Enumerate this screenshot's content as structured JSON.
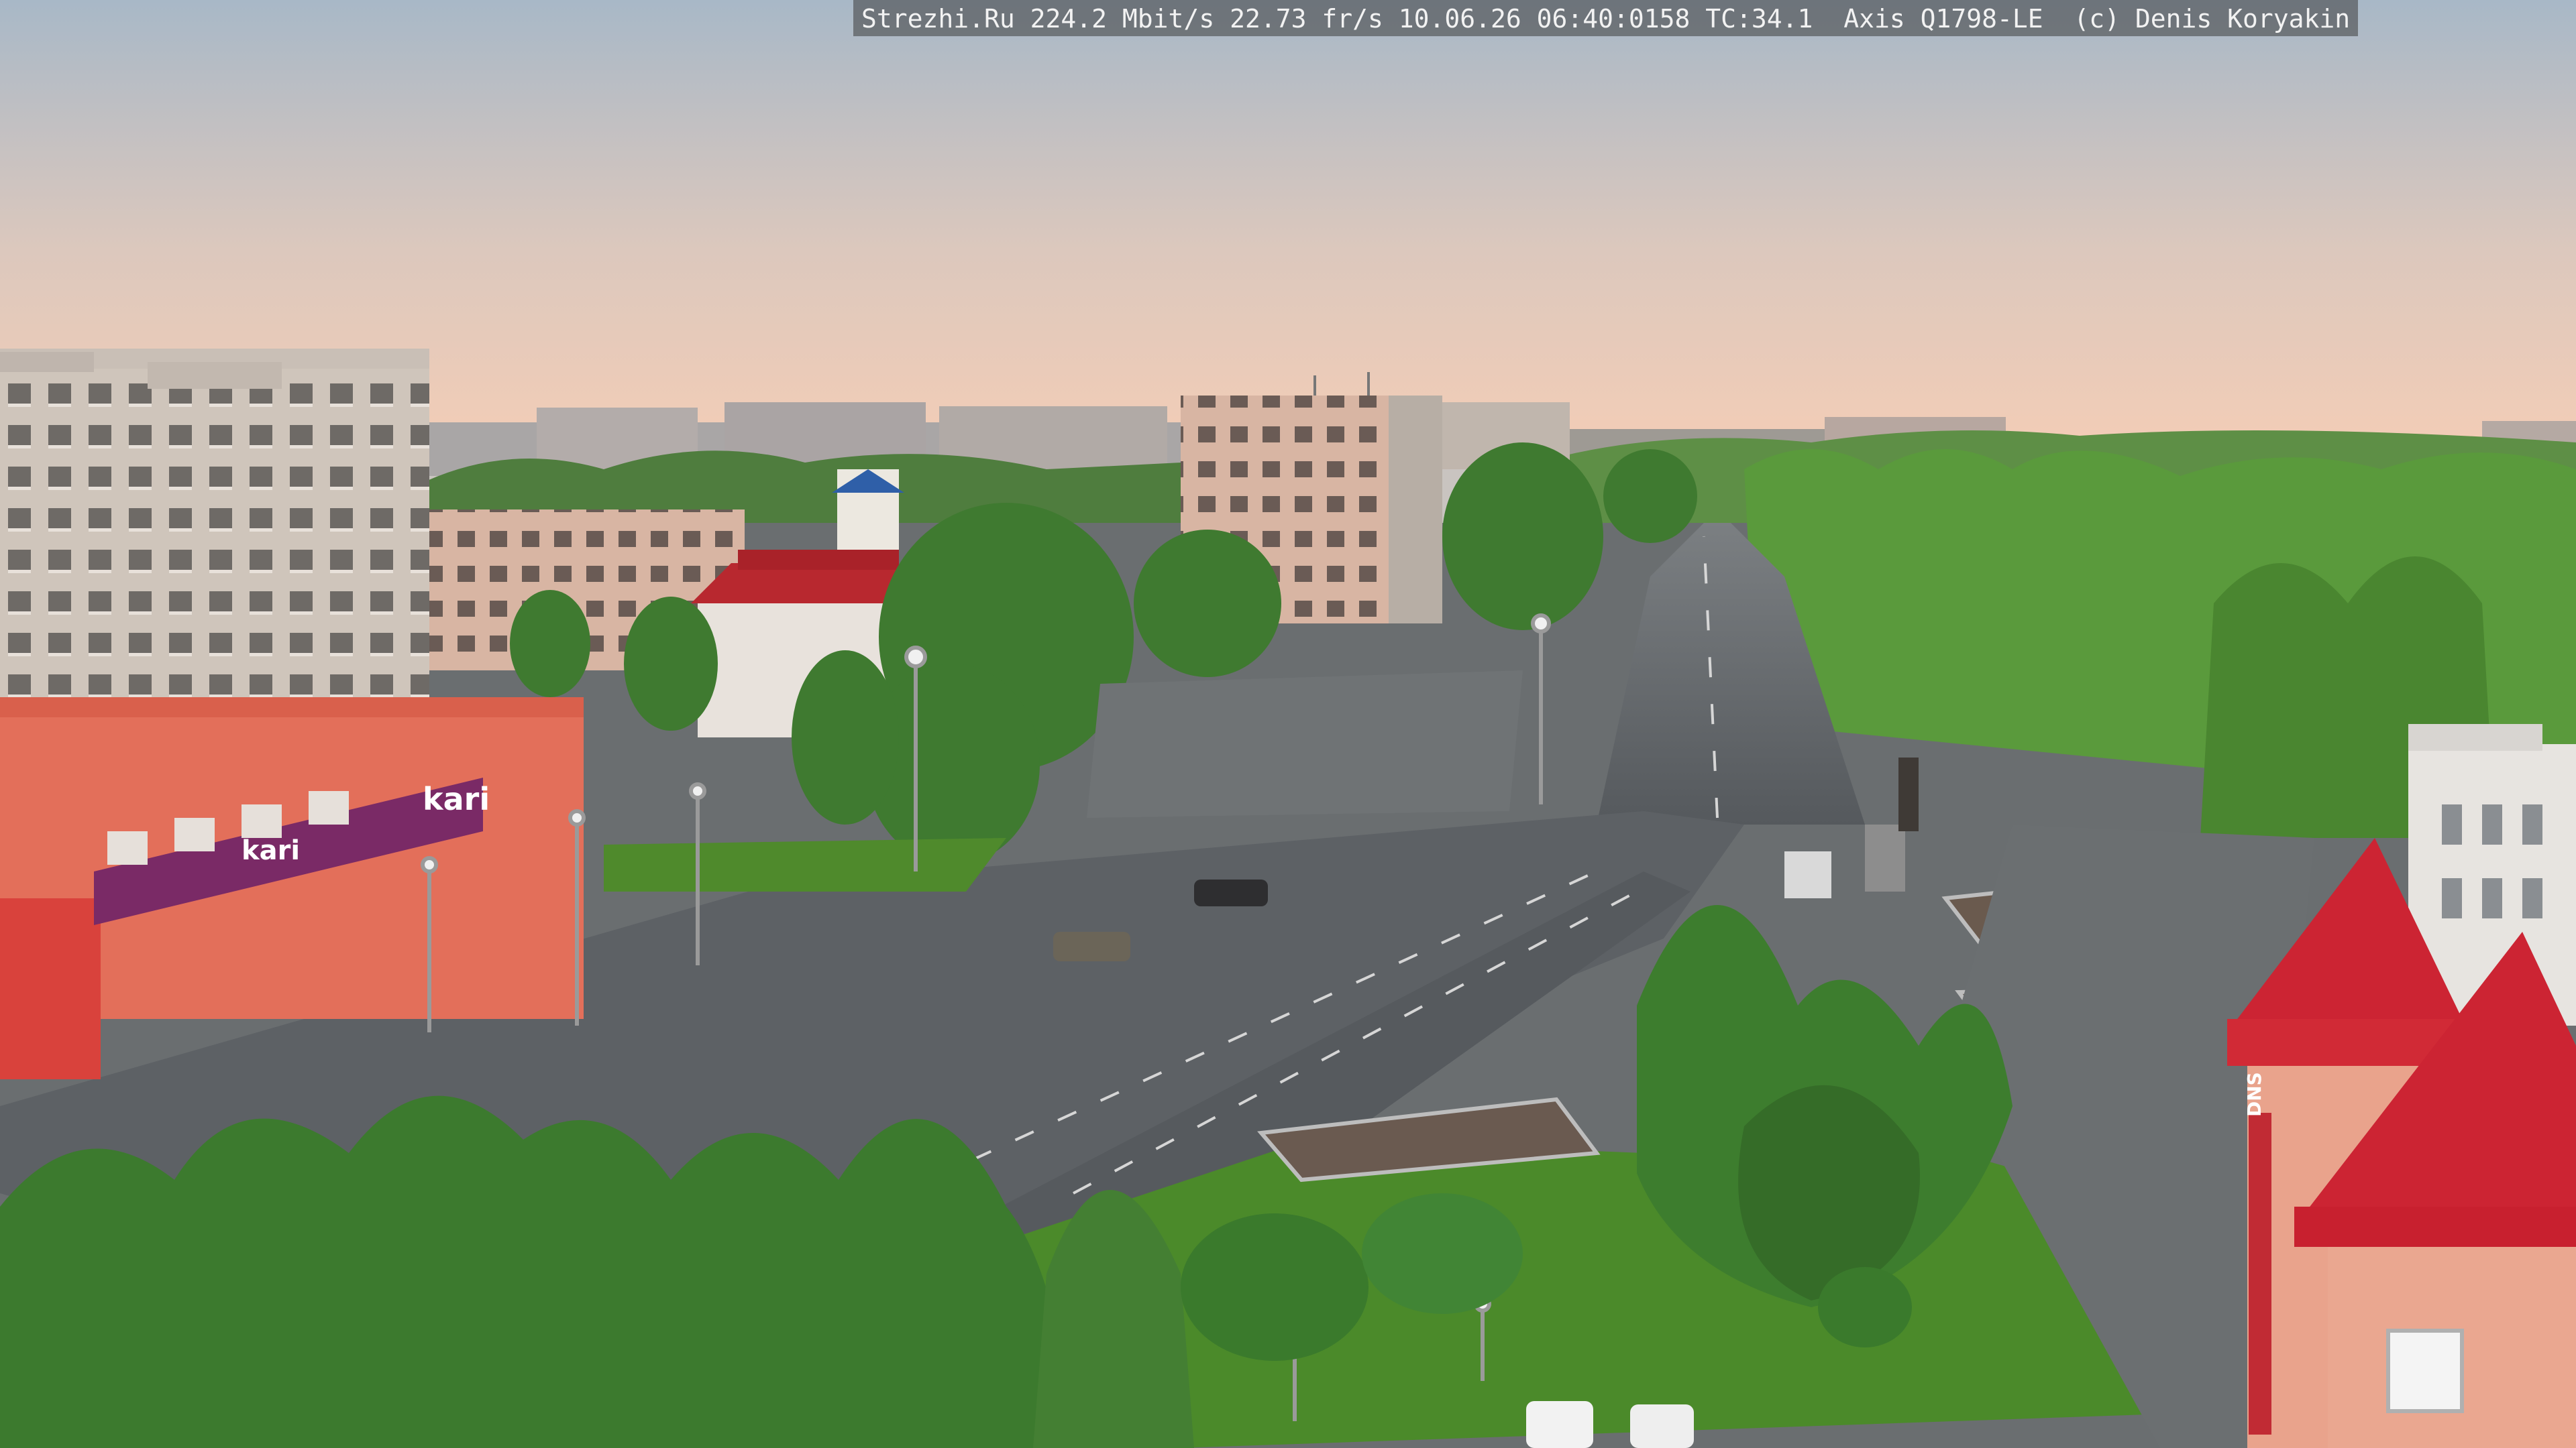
{
  "camera_overlay": {
    "text": "Strezhi.Ru 224.2 Mbit/s 22.73 fr/s 10.06.26 06:40:0158 TC:34.1  Axis Q1798-LE  (c) Denis Koryakin"
  },
  "signage": {
    "store_logo": "kari",
    "store_banner_logo": "kari",
    "tower_sign": "DNS"
  },
  "colors": {
    "sky_top": "#a9b9c9",
    "sky_horizon": "#f3cdb8",
    "asphalt": "#5f6468",
    "grass": "#4d8a2e",
    "trees": "#3f7a30",
    "coral_building": "#e2735e",
    "red_roof": "#c8242f",
    "kari_banner": "#7a2a66"
  }
}
